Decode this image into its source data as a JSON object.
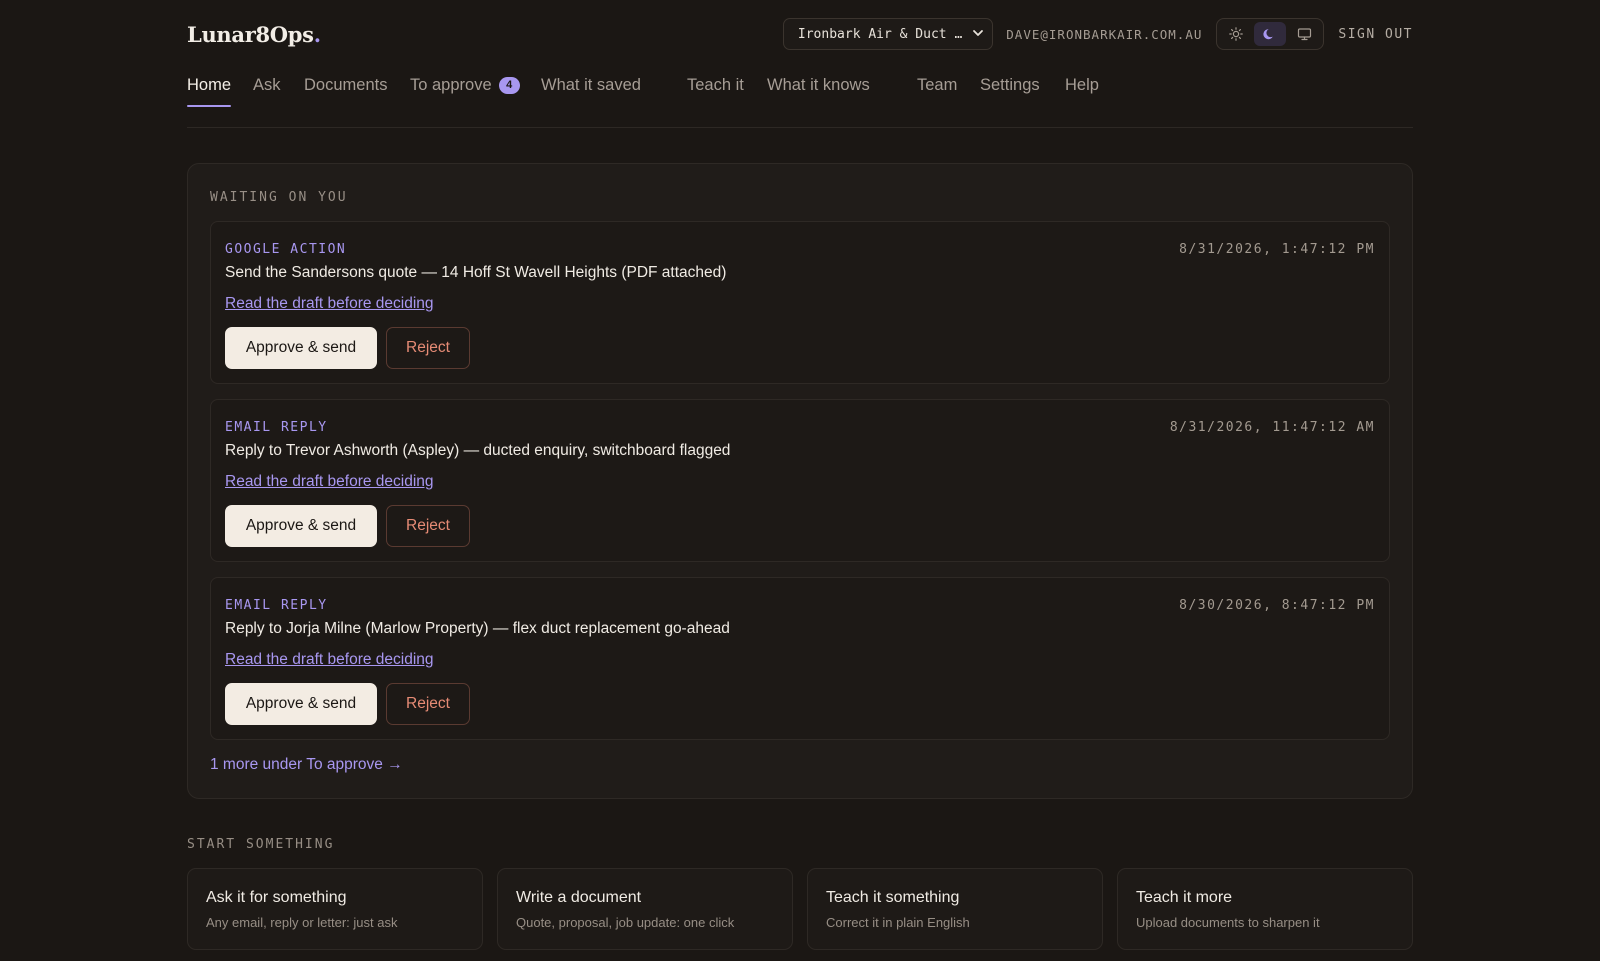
{
  "brand": {
    "name": "Lunar8Ops",
    "dot": "."
  },
  "header": {
    "org_selected": "Ironbark Air & Duct …",
    "user_email": "DAVE@IRONBARKAIR.COM.AU",
    "theme_modes": [
      "light",
      "dark",
      "system"
    ],
    "theme_active": "dark",
    "signout_label": "SIGN OUT"
  },
  "nav": {
    "items": [
      {
        "label": "Home",
        "active": true
      },
      {
        "label": "Ask"
      },
      {
        "label": "Documents"
      },
      {
        "label": "To approve",
        "badge": "4"
      },
      {
        "label": "What it saved"
      },
      {
        "label": "Teach it"
      },
      {
        "label": "What it knows"
      },
      {
        "label": "Team"
      },
      {
        "label": "Settings"
      },
      {
        "label": "Help"
      }
    ]
  },
  "waiting": {
    "label": "WAITING ON YOU",
    "items": [
      {
        "kind": "GOOGLE ACTION",
        "timestamp": "8/31/2026, 1:47:12 PM",
        "title": "Send the Sandersons quote — 14 Hoff St Wavell Heights (PDF attached)",
        "draft_link": "Read the draft before deciding",
        "approve": "Approve & send",
        "reject": "Reject"
      },
      {
        "kind": "EMAIL REPLY",
        "timestamp": "8/31/2026, 11:47:12 AM",
        "title": "Reply to Trevor Ashworth (Aspley) — ducted enquiry, switchboard flagged",
        "draft_link": "Read the draft before deciding",
        "approve": "Approve & send",
        "reject": "Reject"
      },
      {
        "kind": "EMAIL REPLY",
        "timestamp": "8/30/2026, 8:47:12 PM",
        "title": "Reply to Jorja Milne (Marlow Property) — flex duct replacement go-ahead",
        "draft_link": "Read the draft before deciding",
        "approve": "Approve & send",
        "reject": "Reject"
      }
    ],
    "more_link": "1 more under To approve →"
  },
  "start": {
    "label": "START SOMETHING",
    "cards": [
      {
        "title": "Ask it for something",
        "subtitle": "Any email, reply or letter: just ask"
      },
      {
        "title": "Write a document",
        "subtitle": "Quote, proposal, job update: one click"
      },
      {
        "title": "Teach it something",
        "subtitle": "Correct it in plain English"
      },
      {
        "title": "Teach it more",
        "subtitle": "Upload documents to sharpen it"
      }
    ]
  },
  "colors": {
    "background": "#1b1714",
    "accent": "#a897f0",
    "reject": "#e68b75",
    "primary_button": "#f3ece3"
  }
}
